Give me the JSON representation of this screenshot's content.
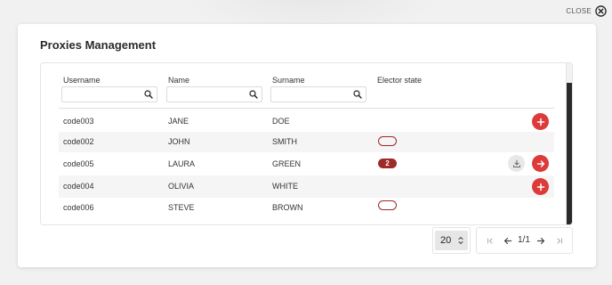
{
  "modal": {
    "close_label": "CLOSE",
    "title": "Proxies Management"
  },
  "table": {
    "columns": [
      {
        "key": "username",
        "label": "Username",
        "filter_value": ""
      },
      {
        "key": "name",
        "label": "Name",
        "filter_value": ""
      },
      {
        "key": "surname",
        "label": "Surname",
        "filter_value": ""
      },
      {
        "key": "elector_state",
        "label": "Elector state"
      }
    ],
    "rows": [
      {
        "username": "code003",
        "name": "JANE",
        "surname": "DOE",
        "elector_state": "",
        "actions": [
          "add"
        ]
      },
      {
        "username": "code002",
        "name": "JOHN",
        "surname": "SMITH",
        "elector_state": "empty-pill",
        "actions": []
      },
      {
        "username": "code005",
        "name": "LAURA",
        "surname": "GREEN",
        "elector_state": "2",
        "actions": [
          "download",
          "go"
        ]
      },
      {
        "username": "code004",
        "name": "OLIVIA",
        "surname": "WHITE",
        "elector_state": "",
        "actions": [
          "add"
        ]
      },
      {
        "username": "code006",
        "name": "STEVE",
        "surname": "BROWN",
        "elector_state": "empty-pill",
        "actions": []
      }
    ]
  },
  "pagination": {
    "page_size": "20",
    "page_label": "1/1"
  },
  "colors": {
    "accent": "#dd3a3a",
    "badge": "#9e2a2a",
    "scrollbar": "#2a2a2a"
  },
  "icons": [
    "close-circle-icon",
    "search-icon",
    "plus-icon",
    "download-icon",
    "arrow-right-icon",
    "first-page-icon",
    "prev-page-icon",
    "next-page-icon",
    "last-page-icon",
    "updown-icon"
  ]
}
